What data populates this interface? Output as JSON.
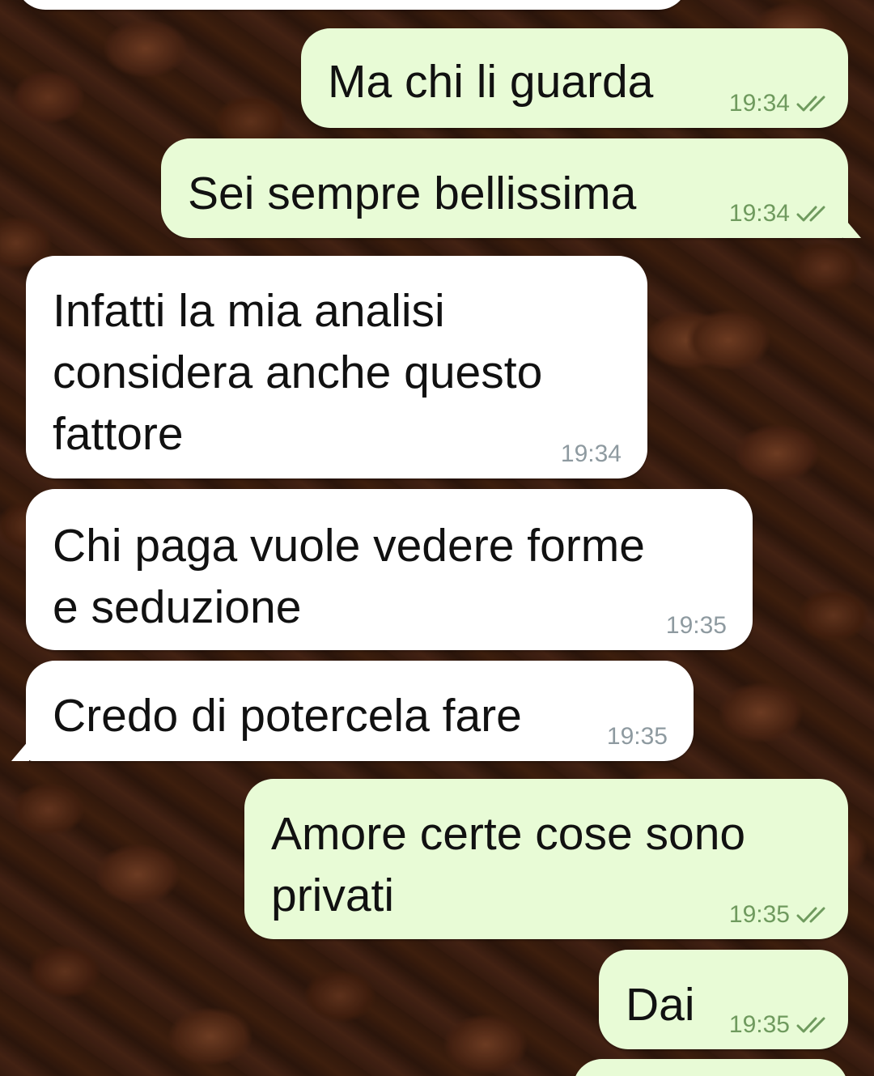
{
  "chat": {
    "messages": [
      {
        "direction": "out",
        "lines": [
          "Ma chi li guarda"
        ],
        "time": "19:34",
        "ticks": "read-ticks-icon"
      },
      {
        "direction": "out",
        "lines": [
          "Sei sempre bellissima"
        ],
        "time": "19:34",
        "ticks": "read-ticks-icon"
      },
      {
        "direction": "in",
        "lines": [
          "Infatti la mia analisi",
          "considera anche questo",
          "fattore"
        ],
        "time": "19:34"
      },
      {
        "direction": "in",
        "lines": [
          "Chi paga vuole vedere forme",
          "e seduzione"
        ],
        "time": "19:35"
      },
      {
        "direction": "in",
        "lines": [
          "Credo di potercela fare"
        ],
        "time": "19:35"
      },
      {
        "direction": "out",
        "lines": [
          "Amore certe cose sono",
          "privati"
        ],
        "time": "19:35",
        "ticks": "read-ticks-icon"
      },
      {
        "direction": "out",
        "lines": [
          "Dai"
        ],
        "time": "19:35",
        "ticks": "read-ticks-icon"
      }
    ]
  },
  "colors": {
    "outgoing_bubble": "#e8fbd6",
    "incoming_bubble": "#ffffff",
    "tick_color": "#6f9a5e",
    "wallpaper": "#3b1f12"
  }
}
